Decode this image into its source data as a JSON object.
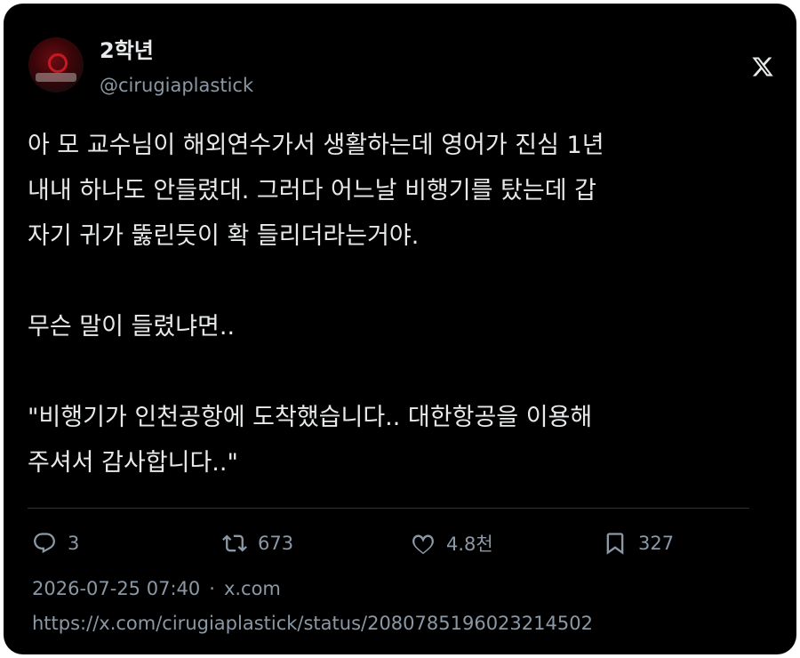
{
  "author": {
    "display_name": "2학년",
    "handle": "@cirugiaplastick",
    "avatar_icon": "profile-photo"
  },
  "brand": {
    "logo_icon": "x-logo-icon",
    "text_color": "#e7e9ea",
    "muted_color": "#8b98a5",
    "background": "#000000"
  },
  "tweet": {
    "text": "아 모 교수님이 해외연수가서 생활하는데 영어가 진심 1년\n내내 하나도 안들렸대. 그러다 어느날 비행기를 탔는데 갑\n자기 귀가 뚫린듯이 확 들리더라는거야.\n\n무슨 말이 들렸냐면..\n\n\"비행기가 인천공항에 도착했습니다.. 대한항공을 이용해\n주셔서 감사합니다..\""
  },
  "actions": {
    "replies": "3",
    "retweets": "673",
    "likes": "4.8천",
    "bookmarks": "327"
  },
  "meta": {
    "timestamp": "2026-07-25 07:40",
    "separator": "·",
    "source": "x.com",
    "url": "https://x.com/cirugiaplastick/status/2080785196023214502"
  }
}
